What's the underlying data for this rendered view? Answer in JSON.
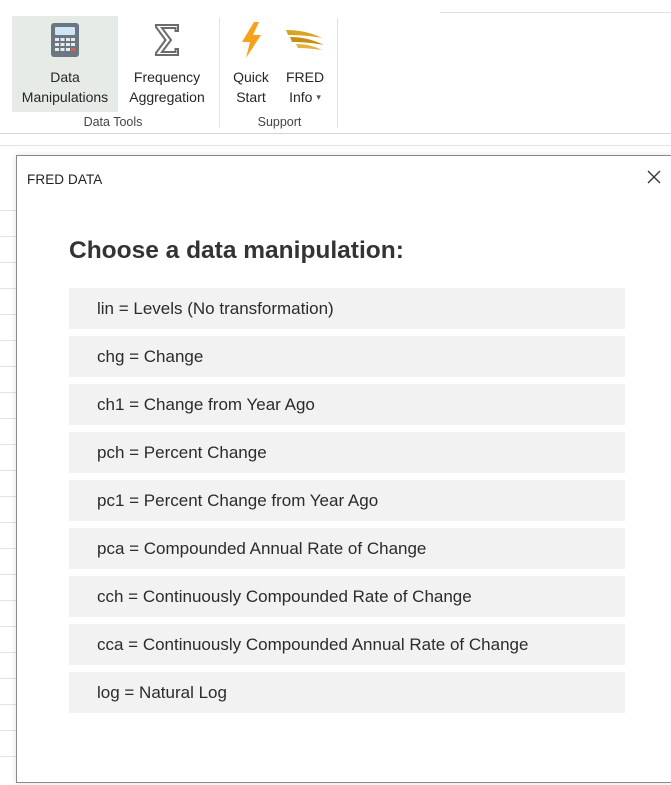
{
  "ribbon": {
    "data_tools": {
      "group_label": "Data Tools",
      "data_manipulations": {
        "line1": "Data",
        "line2": "Manipulations",
        "icon": "calculator-icon"
      },
      "frequency_aggregation": {
        "line1": "Frequency",
        "line2": "Aggregation",
        "icon": "sigma-icon"
      }
    },
    "support": {
      "group_label": "Support",
      "quick_start": {
        "line1": "Quick",
        "line2": "Start",
        "icon": "lightning-icon"
      },
      "fred_info": {
        "line1": "FRED",
        "line2": "Info",
        "icon": "eagle-icon",
        "caret": "▾"
      }
    }
  },
  "dialog": {
    "title": "FRED DATA",
    "close_glyph": "×",
    "heading": "Choose a data manipulation:",
    "options": [
      "lin = Levels (No transformation)",
      "chg = Change",
      "ch1 = Change from Year Ago",
      "pch = Percent Change",
      "pc1 = Percent Change from Year Ago",
      "pca = Compounded Annual Rate of Change",
      "cch = Continuously Compounded Rate of Change",
      "cca = Continuously Compounded Annual Rate of Change",
      "log = Natural Log"
    ]
  },
  "colors": {
    "active_button_bg": "#e7ebe7",
    "option_bg": "#f2f2f2",
    "lightning": "#f7a21b",
    "eagle": "#d9a521"
  }
}
